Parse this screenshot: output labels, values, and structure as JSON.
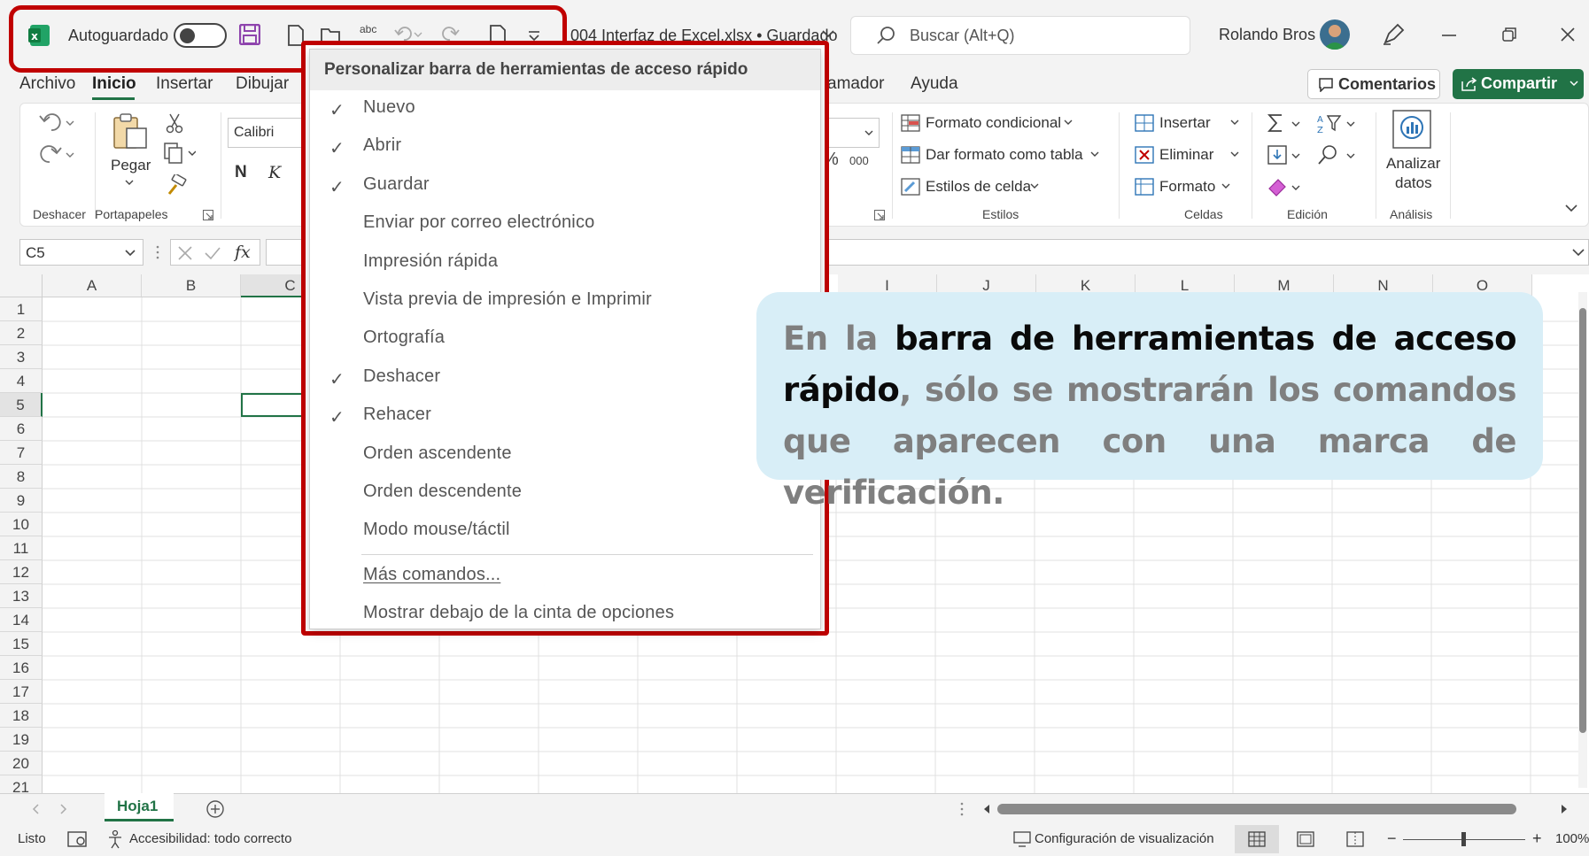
{
  "titlebar": {
    "autosave_label": "Autoguardado",
    "save_state": "off",
    "spell_label": "abc",
    "document_title": "004 Interfaz de Excel.xlsx • Guardado",
    "search_placeholder": "Buscar (Alt+Q)",
    "user_name": "Rolando Bros"
  },
  "tabs": [
    "Archivo",
    "Inicio",
    "Insertar",
    "Dibujar",
    "amador",
    "Ayuda"
  ],
  "active_tab": "Inicio",
  "actions": {
    "comments": "Comentarios",
    "share": "Compartir"
  },
  "ribbon": {
    "undo_group": "Deshacer",
    "clipboard_group": "Portapapeles",
    "paste": "Pegar",
    "font_name": "Calibri",
    "bold": "N",
    "italic": "K",
    "number_thousands": "000",
    "percent": "%",
    "styles": {
      "conditional": "Formato condicional",
      "table": "Dar formato como tabla",
      "cell_styles": "Estilos de celda",
      "group": "Estilos"
    },
    "cells": {
      "insert": "Insertar",
      "delete": "Eliminar",
      "format": "Formato",
      "group": "Celdas"
    },
    "editing_group": "Edición",
    "analysis": {
      "line1": "Analizar",
      "line2": "datos",
      "group": "Análisis"
    }
  },
  "formula_bar": {
    "name_box": "C5",
    "fx": "fx",
    "value": ""
  },
  "grid": {
    "columns": [
      "A",
      "B",
      "C",
      "I",
      "J",
      "K",
      "L",
      "M",
      "N",
      "O"
    ],
    "rows": [
      "1",
      "2",
      "3",
      "4",
      "5",
      "6",
      "7",
      "8",
      "9",
      "10",
      "11",
      "12",
      "13",
      "14",
      "15",
      "16",
      "17",
      "18",
      "19",
      "20",
      "21"
    ],
    "selected_cell": "C5"
  },
  "sheet_tabs": [
    "Hoja1"
  ],
  "status": {
    "ready": "Listo",
    "accessibility": "Accesibilidad: todo correcto",
    "display_settings": "Configuración de visualización",
    "zoom": "100%"
  },
  "qat_menu": {
    "title": "Personalizar barra de herramientas de acceso rápido",
    "items": [
      {
        "label": "Nuevo",
        "checked": true
      },
      {
        "label": "Abrir",
        "checked": true
      },
      {
        "label": "Guardar",
        "checked": true
      },
      {
        "label": "Enviar por correo electrónico",
        "checked": false
      },
      {
        "label": "Impresión rápida",
        "checked": false
      },
      {
        "label": "Vista previa de impresión e Imprimir",
        "checked": false
      },
      {
        "label": "Ortografía",
        "checked": false
      },
      {
        "label": "Deshacer",
        "checked": true
      },
      {
        "label": "Rehacer",
        "checked": true
      },
      {
        "label": "Orden ascendente",
        "checked": false
      },
      {
        "label": "Orden descendente",
        "checked": false
      },
      {
        "label": "Modo mouse/táctil",
        "checked": false
      }
    ],
    "more_commands": "Más comandos...",
    "show_below": "Mostrar debajo de la cinta de opciones"
  },
  "callout": {
    "part1": "En la ",
    "strong1": "barra de herramientas de acceso rápido",
    "part2": ", sólo se mostrarán los comandos que aparecen con una marca de verificación."
  },
  "colors": {
    "excel_green": "#217346",
    "highlight_red": "#c00000",
    "callout_bg": "#d8eef7"
  }
}
